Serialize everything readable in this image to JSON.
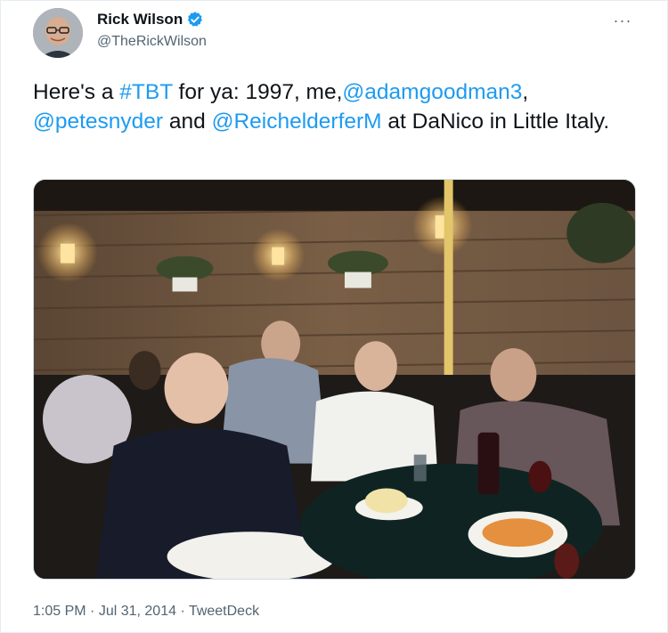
{
  "author": {
    "name": "Rick Wilson",
    "handle": "@TheRickWilson",
    "verified": true
  },
  "tweet": {
    "segments": [
      {
        "text": "Here's a ",
        "link": false
      },
      {
        "text": "#TBT",
        "link": true
      },
      {
        "text": " for ya: 1997, me,",
        "link": false
      },
      {
        "text": "@adamgoodman3",
        "link": true
      },
      {
        "text": ", ",
        "link": false
      },
      {
        "text": "@petesnyder",
        "link": true
      },
      {
        "text": " and ",
        "link": false
      },
      {
        "text": "@ReichelderferM",
        "link": true
      },
      {
        "text": " at DaNico in Little Italy.",
        "link": false
      }
    ]
  },
  "media": {
    "type": "photo"
  },
  "meta": {
    "time": "1:05 PM",
    "separator1": " · ",
    "date": "Jul 31, 2014",
    "separator2": " · ",
    "source": "TweetDeck"
  },
  "colors": {
    "link": "#1d9bf0",
    "verified": "#1d9bf0",
    "secondary": "#536471"
  },
  "icons": {
    "more": "more-horizontal-icon",
    "verified": "verified-badge-icon"
  },
  "more_label": "···"
}
